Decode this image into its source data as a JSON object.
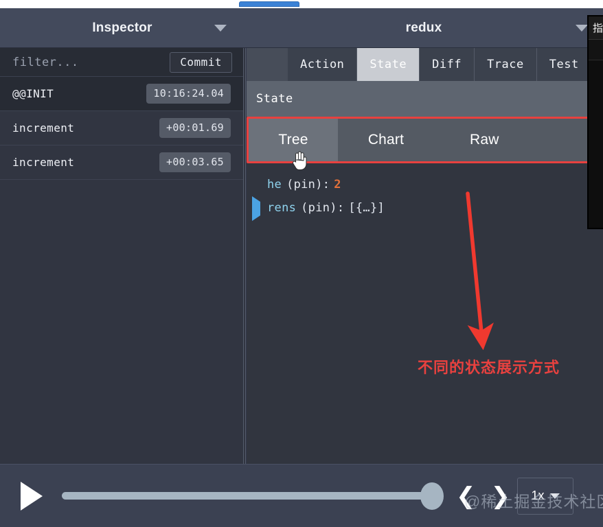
{
  "window": {
    "tab_indicator_color": "#3b82d6"
  },
  "header": {
    "left_title": "Inspector",
    "right_title": "redux",
    "left_caret_icon": "chevron-down-icon",
    "right_caret_icon": "chevron-down-icon"
  },
  "left_pane": {
    "filter": {
      "placeholder": "filter...",
      "value": ""
    },
    "commit_label": "Commit",
    "actions": [
      {
        "name": "@@INIT",
        "time": "10:16:24.04",
        "selected": true
      },
      {
        "name": "increment",
        "time": "+00:01.69",
        "selected": false
      },
      {
        "name": "increment",
        "time": "+00:03.65",
        "selected": false
      }
    ]
  },
  "right_pane": {
    "monitor_tabs": [
      {
        "label": "Action",
        "active": false
      },
      {
        "label": "State",
        "active": true
      },
      {
        "label": "Diff",
        "active": false
      },
      {
        "label": "Trace",
        "active": false
      },
      {
        "label": "Test",
        "active": false
      }
    ],
    "section_label": "State",
    "view_tabs": [
      {
        "label": "Tree",
        "active": true
      },
      {
        "label": "Chart",
        "active": false
      },
      {
        "label": "Raw",
        "active": false
      }
    ],
    "tree": [
      {
        "expandable": false,
        "key": "he",
        "meta": "(pin):",
        "value": "2",
        "value_kind": "number"
      },
      {
        "expandable": true,
        "key": "rens",
        "meta": "(pin):",
        "value": "[{…}]",
        "value_kind": "object",
        "expander_icon": "triangle-right-icon"
      }
    ]
  },
  "annotation": {
    "text": "不同的状态展示方式",
    "color": "#e8413f",
    "arrow_icon": "down-arrow-icon",
    "highlight_color": "#e8413f"
  },
  "float_panel": {
    "header_text": "指"
  },
  "player": {
    "play_icon": "play-icon",
    "prev_icon": "chevron-left-icon",
    "next_icon": "chevron-right-icon",
    "speed_value": "1x",
    "speed_caret_icon": "chevron-down-icon",
    "slider_percent": 100
  },
  "watermark": {
    "text": "@稀土掘金技术社区"
  }
}
